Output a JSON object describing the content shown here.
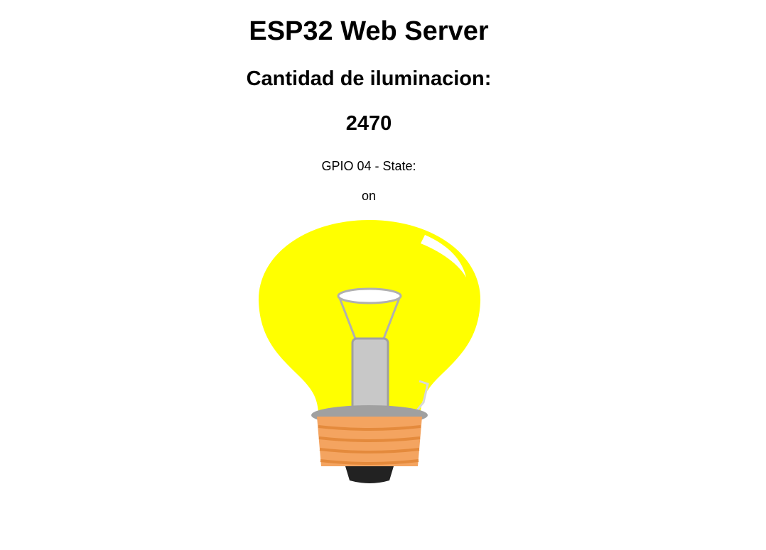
{
  "page": {
    "title": "ESP32 Web Server",
    "subtitle": "Cantidad de iluminacion:",
    "reading": "2470",
    "gpio_label": "GPIO 04 - State:",
    "gpio_state": "on"
  },
  "bulb": {
    "icon": "lightbulb-on-icon",
    "state": "on",
    "colors": {
      "glass": "#ffff00",
      "highlight": "#ffffff",
      "filament": "#c8c8c8",
      "socket": "#f4a460",
      "socket_shadow": "#a0a0a0",
      "tip": "#222222"
    }
  }
}
